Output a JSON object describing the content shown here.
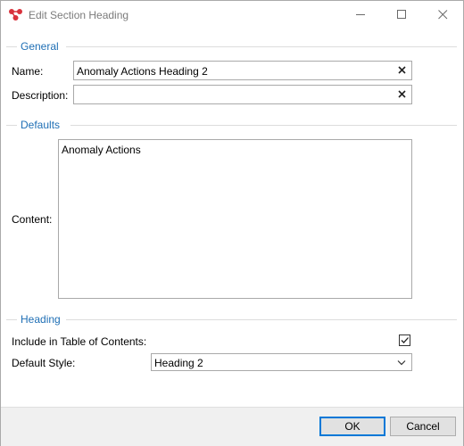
{
  "window": {
    "title": "Edit Section Heading",
    "controls": {
      "minimize": "minimize",
      "maximize": "maximize",
      "close": "close"
    }
  },
  "general": {
    "header": "General",
    "name_label": "Name:",
    "name_value": "Anomaly Actions Heading 2",
    "description_label": "Description:",
    "description_value": ""
  },
  "defaults": {
    "header": "Defaults",
    "content_label": "Content:",
    "content_value": "Anomaly Actions"
  },
  "heading": {
    "header": "Heading",
    "toc_label": "Include in Table of Contents:",
    "toc_checked": true,
    "style_label": "Default Style:",
    "style_value": "Heading 2"
  },
  "buttons": {
    "ok": "OK",
    "cancel": "Cancel"
  },
  "colors": {
    "section_header": "#1f6fb5",
    "accent_border": "#0078d7",
    "footer_bg": "#f0f0f0"
  }
}
